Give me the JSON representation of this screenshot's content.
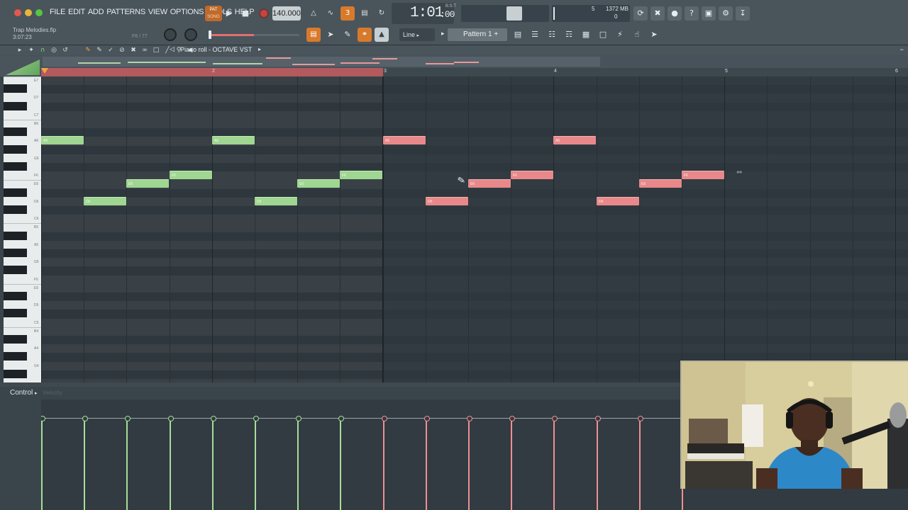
{
  "menu": [
    "FILE",
    "EDIT",
    "ADD",
    "PATTERNS",
    "VIEW",
    "OPTIONS",
    "TOOLS",
    "HELP"
  ],
  "transport": {
    "pat_label": "PAT",
    "song_label": "SONG",
    "tempo": "140.000",
    "time": "1:01",
    "time_sub": ":00",
    "time_label": "B:S:T"
  },
  "cpu": {
    "voices": "5",
    "memory": "1372 MB",
    "poly": "0"
  },
  "project": {
    "name": "Trap Melodies.flp",
    "time": "3:07:23",
    "note_hint": "F6 / 77"
  },
  "snap": {
    "mode": "Line"
  },
  "pattern": {
    "name": "Pattern 1"
  },
  "piano_roll": {
    "title": "Piano roll - OCTAVE VST",
    "bars": [
      "2",
      "3",
      "4",
      "5",
      "6"
    ],
    "key_labels": [
      "E7",
      "D7",
      "C7",
      "B6",
      "A6",
      "G6",
      "F6",
      "E6",
      "D6",
      "C6",
      "B5",
      "A5",
      "G5",
      "F5",
      "E5",
      "D5",
      "C5",
      "B4",
      "A4",
      "G4"
    ],
    "notes": [
      {
        "label": "A6",
        "color": "green"
      },
      {
        "label": "D6",
        "color": "green"
      },
      {
        "label": "E6",
        "color": "green"
      },
      {
        "label": "F6",
        "color": "green"
      },
      {
        "label": "A6",
        "color": "green"
      },
      {
        "label": "D6",
        "color": "green"
      },
      {
        "label": "E6",
        "color": "green"
      },
      {
        "label": "F6",
        "color": "green"
      },
      {
        "label": "A6",
        "color": "red"
      },
      {
        "label": "D6",
        "color": "red"
      },
      {
        "label": "E6",
        "color": "red"
      },
      {
        "label": "F6",
        "color": "red"
      },
      {
        "label": "A6",
        "color": "red"
      },
      {
        "label": "D6",
        "color": "red"
      },
      {
        "label": "E6",
        "color": "red"
      },
      {
        "label": "F6",
        "color": "red"
      }
    ]
  },
  "control": {
    "label": "Control",
    "ghost": "Velocity"
  },
  "colors": {
    "accent": "#d77a2c",
    "green_note": "#9fd691",
    "red_note": "#e8888a",
    "background": "#323b41"
  }
}
